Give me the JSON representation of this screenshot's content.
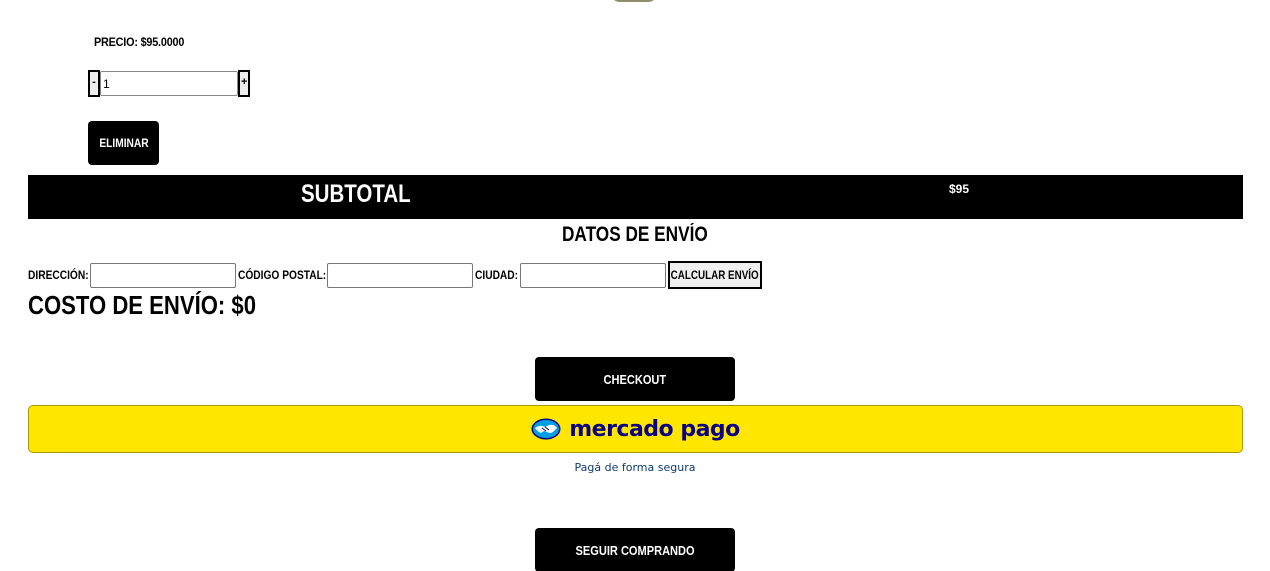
{
  "cart": {
    "price_text": "PRECIO: $95.0000",
    "quantity": {
      "minus_label": "-",
      "value": "1",
      "plus_label": "+"
    },
    "remove_label": "ELIMINAR"
  },
  "subtotal": {
    "label": "SUBTOTAL",
    "value": "$95"
  },
  "shipping": {
    "title": "DATOS DE ENVÍO",
    "address_label": "DIRECCIÓN:",
    "address_value": "",
    "postal_label": "CÓDIGO POSTAL:",
    "postal_value": "",
    "city_label": "CIUDAD:",
    "city_value": "",
    "calc_label": "CALCULAR ENVÍO",
    "cost_text": "COSTO DE ENVÍO: $0"
  },
  "actions": {
    "checkout_label": "CHECKOUT",
    "mercadopago_text": "mercado pago",
    "mercadopago_icon": "handshake-icon",
    "secure_text": "Pagá de forma segura",
    "continue_label": "SEGUIR COMPRANDO"
  },
  "colors": {
    "primary": "#000000",
    "mercadopago_yellow": "#ffe600",
    "mercadopago_navy": "#0a0080",
    "mercadopago_blue": "#009ee3"
  }
}
